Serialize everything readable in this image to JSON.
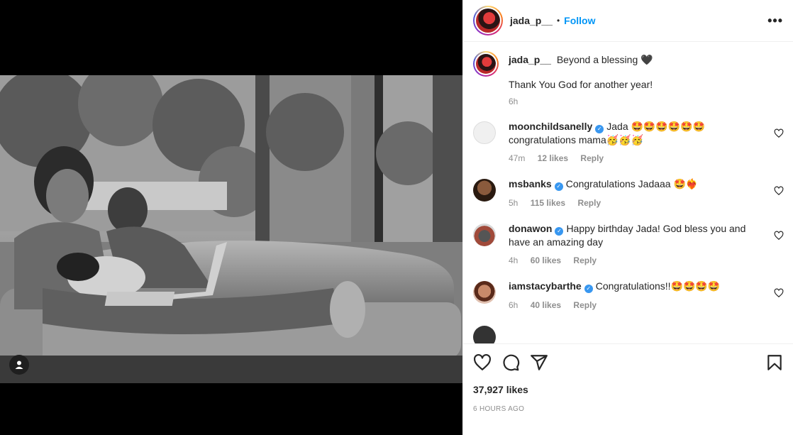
{
  "post": {
    "username": "jada_p__",
    "follow_label": "Follow",
    "separator": "•",
    "more_label": "•••",
    "likes": "37,927 likes",
    "time_ago": "6 HOURS AGO"
  },
  "caption": {
    "username": "jada_p__",
    "line1": "Beyond a blessing 🖤",
    "line2": "Thank You God for another year!",
    "time": "6h"
  },
  "comments": [
    {
      "username": "moonchildsanelly",
      "text": "Jada 🤩🤩🤩🤩🤩🤩 congratulations mama🥳🥳🥳",
      "time": "47m",
      "likes": "12 likes",
      "reply": "Reply"
    },
    {
      "username": "msbanks",
      "text": "Congratulations Jadaaa 🤩❤️‍🔥",
      "time": "5h",
      "likes": "115 likes",
      "reply": "Reply"
    },
    {
      "username": "donawon",
      "text": "Happy birthday Jada! God bless you and have an amazing day",
      "time": "4h",
      "likes": "60 likes",
      "reply": "Reply"
    },
    {
      "username": "iamstacybarthe",
      "text": "Congratulations!!🤩🤩🤩🤩",
      "time": "6h",
      "likes": "40 likes",
      "reply": "Reply"
    }
  ],
  "icons": {
    "like": "heart-icon",
    "comment": "comment-icon",
    "share": "share-icon",
    "save": "bookmark-icon",
    "more": "more-icon",
    "tag": "user-tag-icon"
  },
  "colors": {
    "accent": "#0095f6",
    "verified": "#3897f0",
    "muted": "#8e8e8e"
  }
}
